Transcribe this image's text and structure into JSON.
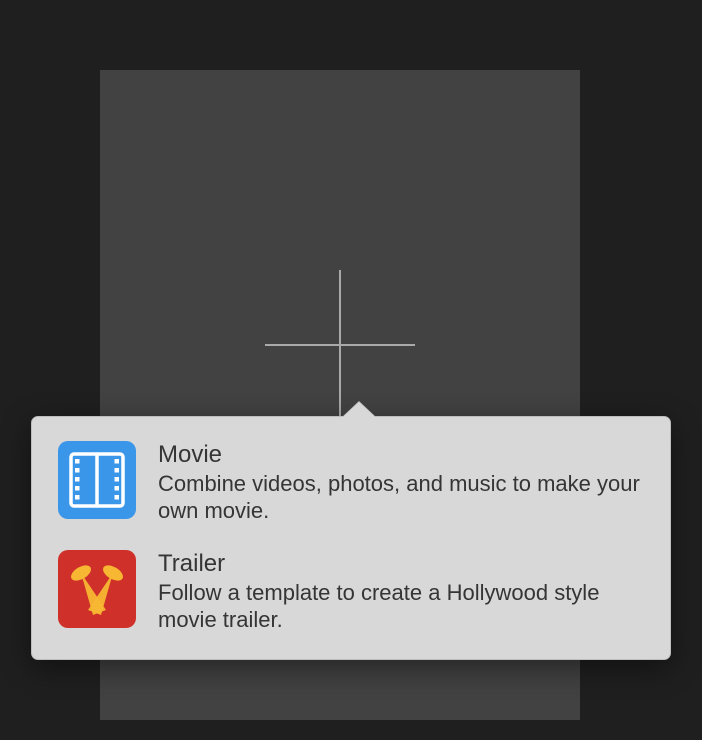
{
  "popover": {
    "options": [
      {
        "icon": "film-icon",
        "title": "Movie",
        "description": "Combine videos, photos, and music to make your own movie."
      },
      {
        "icon": "spotlight-icon",
        "title": "Trailer",
        "description": "Follow a template to create a Hollywood style movie trailer."
      }
    ]
  },
  "colors": {
    "tile_bg": "#424242",
    "popover_bg": "#d8d8d8",
    "movie_icon_bg": "#3a96e8",
    "trailer_icon_bg": "#cf3029"
  }
}
